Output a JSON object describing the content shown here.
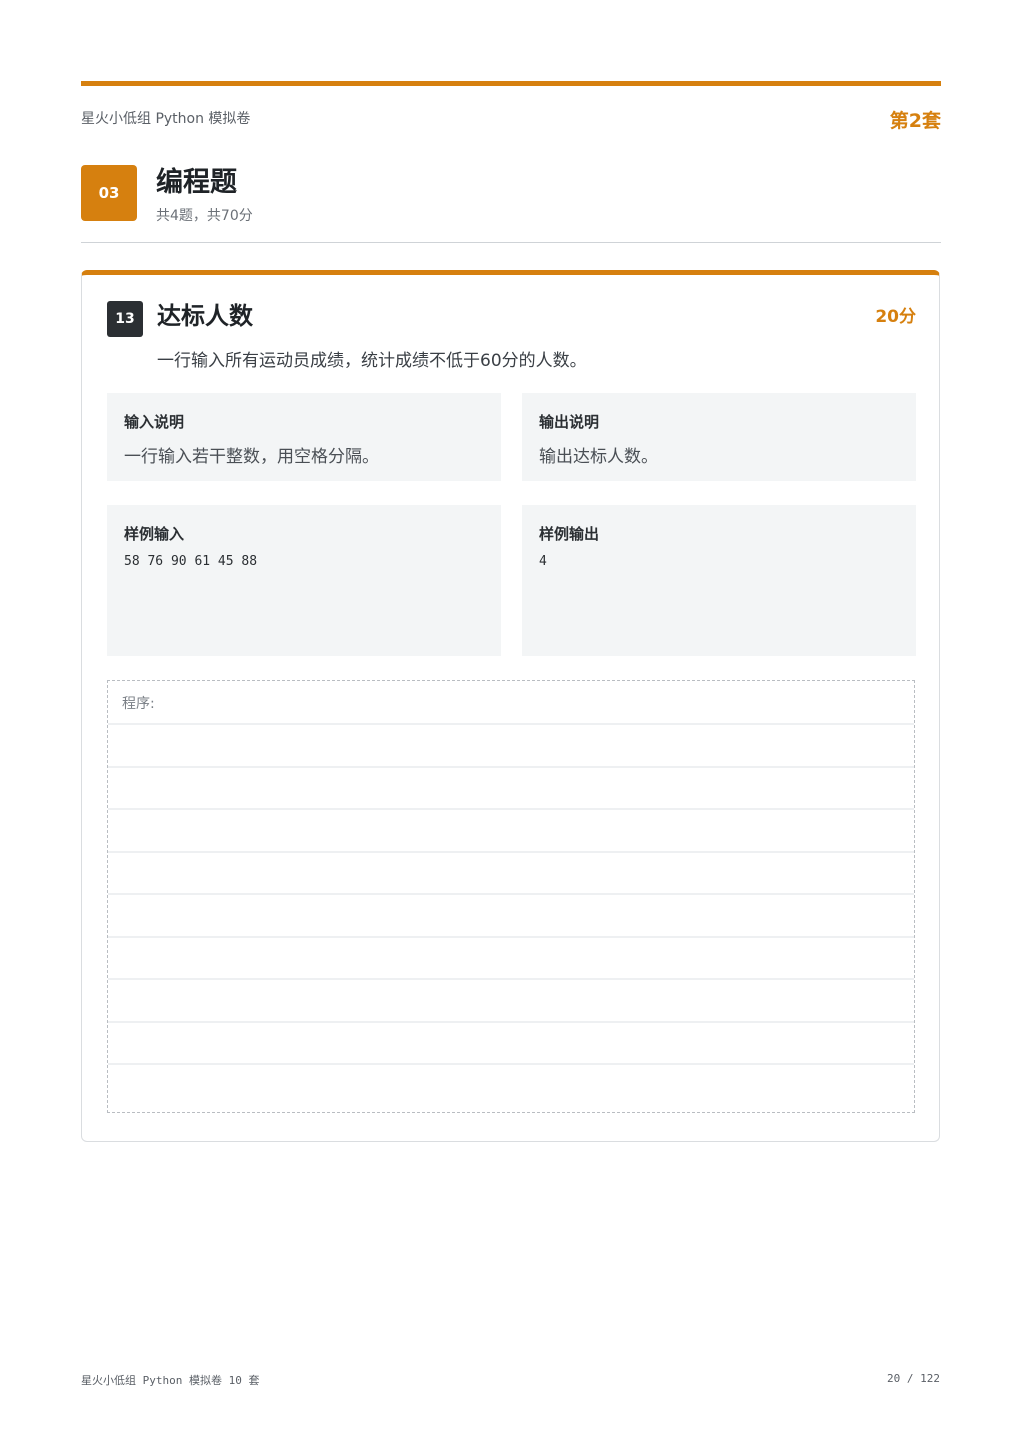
{
  "header": {
    "doc_title": "星火小低组 Python 模拟卷",
    "set_label": "第2套"
  },
  "section": {
    "number": "03",
    "title": "编程题",
    "summary": "共4题，共70分"
  },
  "question": {
    "number": "13",
    "title": "达标人数",
    "score": "20分",
    "description": "一行输入所有运动员成绩，统计成绩不低于60分的人数。",
    "input_spec": {
      "label": "输入说明",
      "text": "一行输入若干整数，用空格分隔。"
    },
    "output_spec": {
      "label": "输出说明",
      "text": "输出达标人数。"
    },
    "sample_input": {
      "label": "样例输入",
      "text": "58 76 90 61 45 88"
    },
    "sample_output": {
      "label": "样例输出",
      "text": "4"
    },
    "answer_area": {
      "label": "程序:"
    }
  },
  "footer": {
    "left": "星火小低组 Python 模拟卷 10 套",
    "page": "20 / 122"
  },
  "colors": {
    "accent": "#d6800f",
    "dark_badge": "#2b2f33",
    "box_bg": "#f3f5f6"
  }
}
